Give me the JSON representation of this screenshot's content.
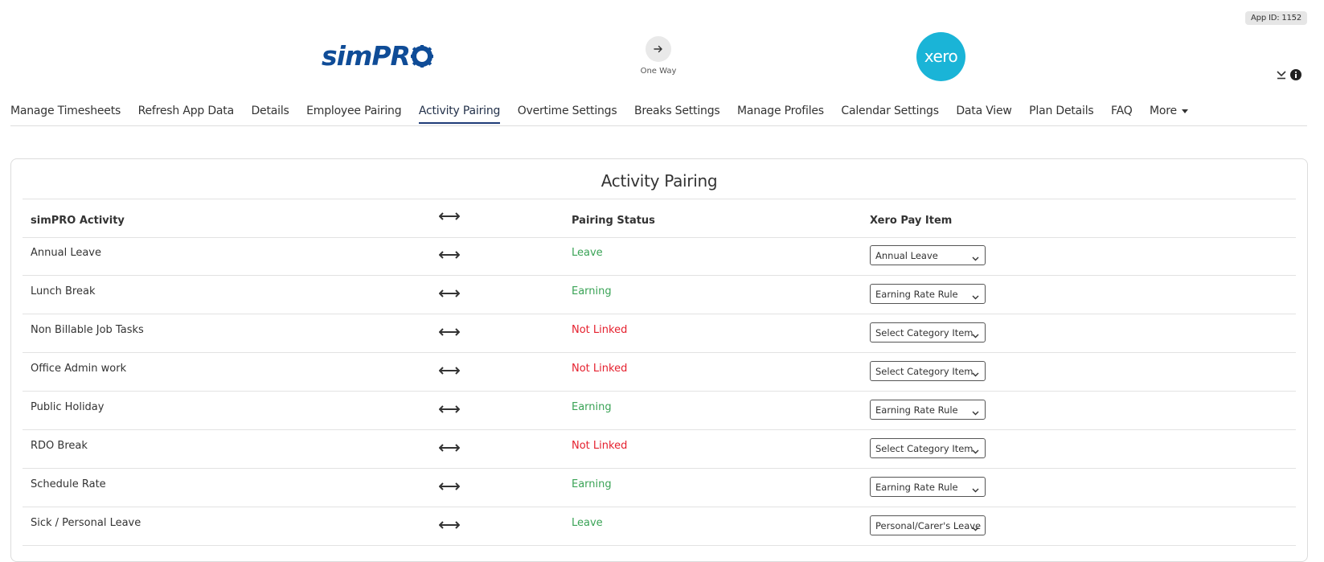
{
  "app_id": "App ID: 1152",
  "logos": {
    "simpro": "simPR",
    "xero": "xero"
  },
  "sync": {
    "direction_label": "One Way",
    "icon": "arrow-right-icon"
  },
  "nav": {
    "items": [
      {
        "label": "Manage Timesheets",
        "active": false
      },
      {
        "label": "Refresh App Data",
        "active": false
      },
      {
        "label": "Details",
        "active": false
      },
      {
        "label": "Employee Pairing",
        "active": false
      },
      {
        "label": "Activity Pairing",
        "active": true
      },
      {
        "label": "Overtime Settings",
        "active": false
      },
      {
        "label": "Breaks Settings",
        "active": false
      },
      {
        "label": "Manage Profiles",
        "active": false
      },
      {
        "label": "Calendar Settings",
        "active": false
      },
      {
        "label": "Data View",
        "active": false
      },
      {
        "label": "Plan Details",
        "active": false
      },
      {
        "label": "FAQ",
        "active": false
      },
      {
        "label": "More",
        "active": false
      }
    ]
  },
  "section": {
    "title": "Activity Pairing",
    "headers": {
      "activity": "simPRO Activity",
      "status": "Pairing Status",
      "pay_item": "Xero Pay Item"
    },
    "rows": [
      {
        "activity": "Annual Leave",
        "status": "Leave",
        "status_kind": "leave",
        "pay_item": "Annual Leave"
      },
      {
        "activity": "Lunch Break",
        "status": "Earning",
        "status_kind": "earning",
        "pay_item": "Earning Rate Rule"
      },
      {
        "activity": "Non Billable Job Tasks",
        "status": "Not Linked",
        "status_kind": "not-linked",
        "pay_item": "Select Category Item"
      },
      {
        "activity": "Office Admin work",
        "status": "Not Linked",
        "status_kind": "not-linked",
        "pay_item": "Select Category Item"
      },
      {
        "activity": "Public Holiday",
        "status": "Earning",
        "status_kind": "earning",
        "pay_item": "Earning Rate Rule"
      },
      {
        "activity": "RDO Break",
        "status": "Not Linked",
        "status_kind": "not-linked",
        "pay_item": "Select Category Item"
      },
      {
        "activity": "Schedule Rate",
        "status": "Earning",
        "status_kind": "earning",
        "pay_item": "Earning Rate Rule"
      },
      {
        "activity": "Sick / Personal Leave",
        "status": "Leave",
        "status_kind": "leave",
        "pay_item": "Personal/Carer's Leave"
      }
    ]
  },
  "colors": {
    "simpro_blue": "#0f4c97",
    "xero_blue": "#1ab4d7",
    "status_green": "#3aa356",
    "status_red": "#e5202e",
    "nav_active_underline": "#1f3c78"
  }
}
